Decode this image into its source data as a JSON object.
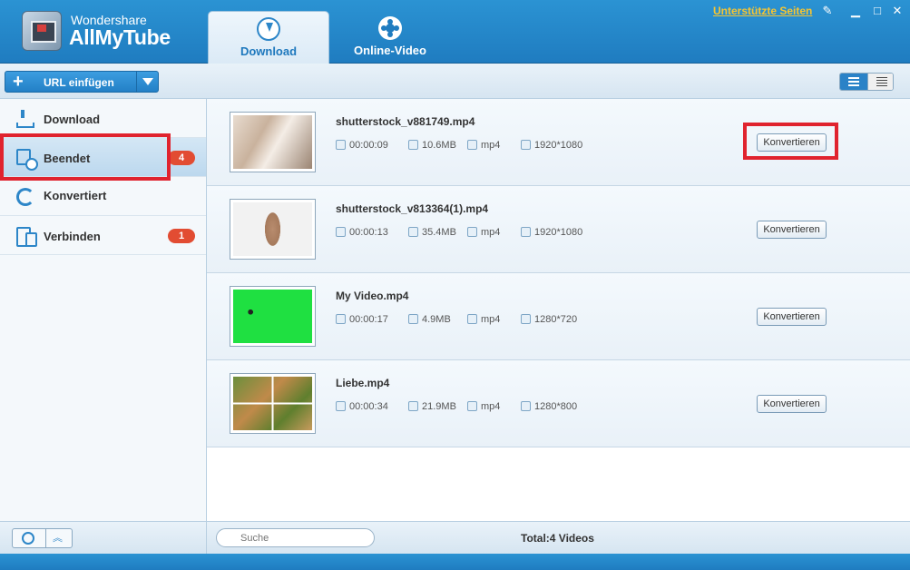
{
  "app": {
    "brand_small": "Wondershare",
    "brand_big": "AllMyTube",
    "supported_sites": "Unterstützte Seiten"
  },
  "tabs": [
    {
      "label": "Download",
      "icon": "download-icon"
    },
    {
      "label": "Online-Video",
      "icon": "film-reel-icon"
    }
  ],
  "toolbar": {
    "url_button": "URL einfügen"
  },
  "sidebar": {
    "items": [
      {
        "label": "Download",
        "icon": "download-icon"
      },
      {
        "label": "Beendet",
        "icon": "finished-icon",
        "badge": "4"
      },
      {
        "label": "Konvertiert",
        "icon": "converted-icon"
      },
      {
        "label": "Verbinden",
        "icon": "connect-icon",
        "badge": "1"
      }
    ]
  },
  "videos": [
    {
      "name": "shutterstock_v881749.mp4",
      "duration": "00:00:09",
      "size": "10.6MB",
      "format": "mp4",
      "resolution": "1920*1080",
      "action": "Konvertieren"
    },
    {
      "name": "shutterstock_v813364(1).mp4",
      "duration": "00:00:13",
      "size": "35.4MB",
      "format": "mp4",
      "resolution": "1920*1080",
      "action": "Konvertieren"
    },
    {
      "name": "My Video.mp4",
      "duration": "00:00:17",
      "size": "4.9MB",
      "format": "mp4",
      "resolution": "1280*720",
      "action": "Konvertieren"
    },
    {
      "name": "Liebe.mp4",
      "duration": "00:00:34",
      "size": "21.9MB",
      "format": "mp4",
      "resolution": "1280*800",
      "action": "Konvertieren"
    }
  ],
  "footer": {
    "search_placeholder": "Suche",
    "total": "Total:4 Videos"
  },
  "colors": {
    "accent": "#1f7cc0",
    "badge": "#e24c32",
    "highlight": "#e0232e",
    "link": "#f7c531"
  }
}
